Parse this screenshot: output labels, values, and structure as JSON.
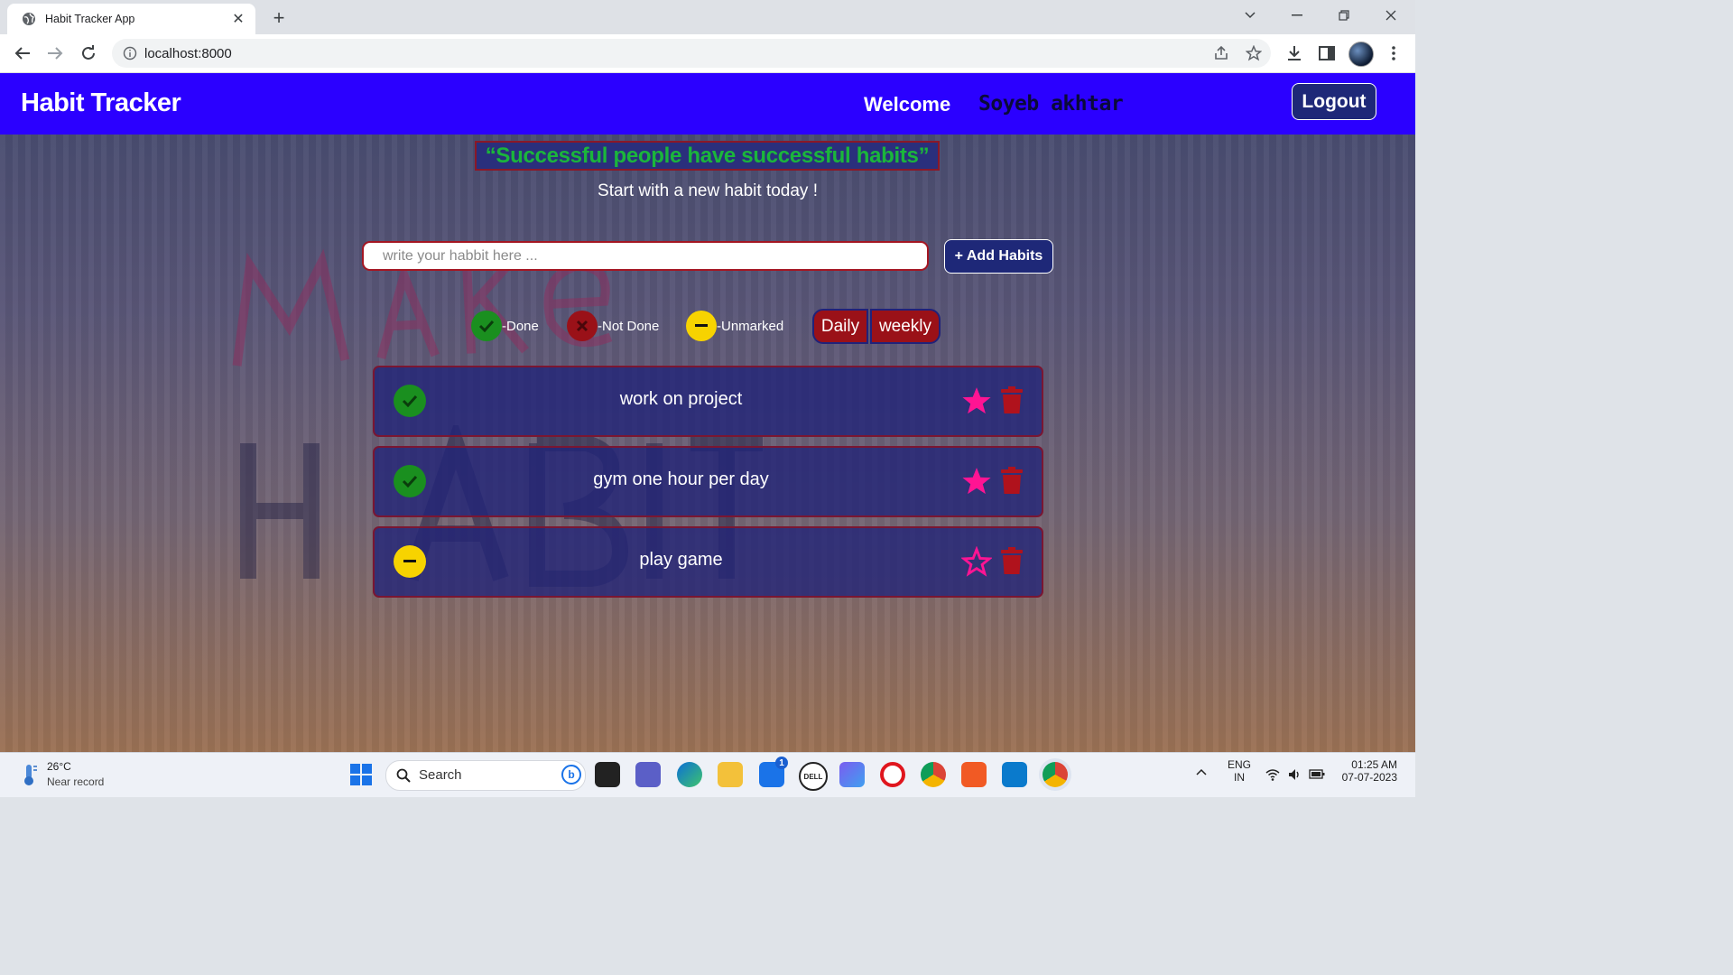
{
  "browser": {
    "tab_title": "Habit Tracker App",
    "url": "localhost:8000"
  },
  "navbar": {
    "brand": "Habit Tracker",
    "welcome": "Welcome",
    "username": "Soyeb akhtar",
    "logout_label": "Logout"
  },
  "hero": {
    "quote": "“Successful people have successful habits”",
    "subtitle": "Start with a new habit today !"
  },
  "form": {
    "input_placeholder": "write your habbit here ...",
    "input_value": "",
    "add_button_label": "+ Add Habits"
  },
  "legend": {
    "done_label": "-Done",
    "not_done_label": "-Not Done",
    "unmarked_label": "-Unmarked"
  },
  "view_toggle": {
    "daily_label": "Daily",
    "weekly_label": "weekly"
  },
  "colors": {
    "navbar": "#2b00ff",
    "done": "#1a8f1f",
    "not_done": "#9a1118",
    "unmarked": "#f7d300",
    "favorite": "#ff1493"
  },
  "habits": [
    {
      "name": "work on project",
      "status": "done",
      "favorite": true
    },
    {
      "name": "gym one hour per day",
      "status": "done",
      "favorite": true
    },
    {
      "name": "play game",
      "status": "unmarked",
      "favorite": false
    }
  ],
  "taskbar": {
    "temperature": "26°C",
    "weather_desc": "Near record",
    "search_label": "Search",
    "language_line1": "ENG",
    "language_line2": "IN",
    "time": "01:25 AM",
    "date": "07-07-2023",
    "mail_badge": "1"
  }
}
